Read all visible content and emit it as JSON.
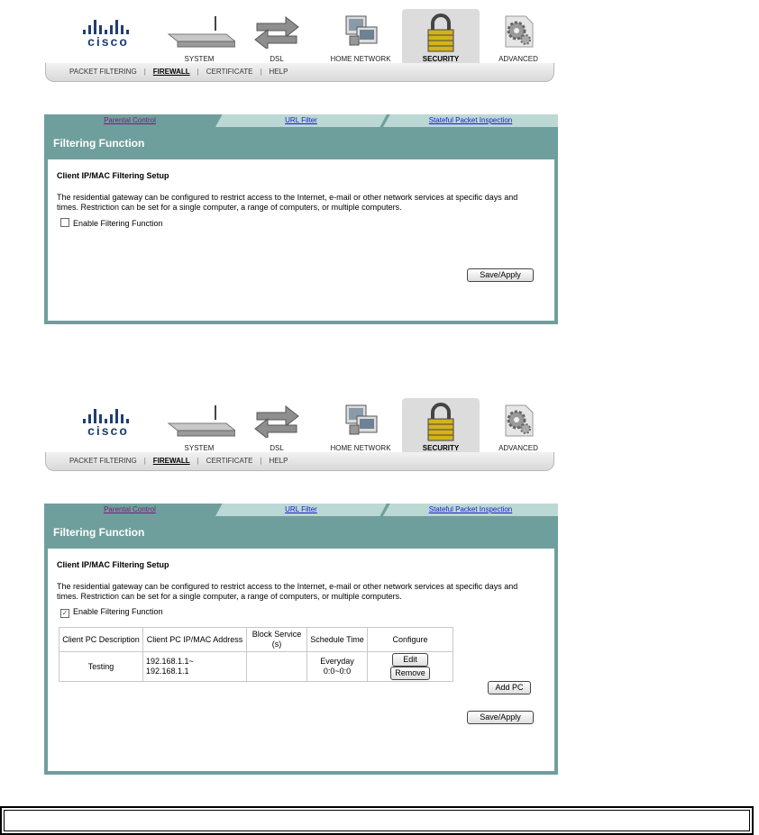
{
  "screens": [
    {
      "header": {
        "logo_text": "cisco",
        "nav": [
          {
            "label": "SYSTEM",
            "icon": "router-icon"
          },
          {
            "label": "DSL",
            "icon": "arrows-icon"
          },
          {
            "label": "HOME NETWORK",
            "icon": "computers-icon"
          },
          {
            "label": "SECURITY",
            "icon": "padlock-icon",
            "active": true
          },
          {
            "label": "ADVANCED",
            "icon": "gears-icon"
          }
        ],
        "subnav": [
          "PACKET FILTERING",
          "FIREWALL",
          "CERTIFICATE",
          "HELP"
        ],
        "subnav_current": "FIREWALL"
      },
      "tabs": [
        "Parental Control",
        "URL Filter",
        "Stateful Packet Inspection"
      ],
      "title": "Filtering Function",
      "subtitle": "Client IP/MAC Filtering Setup",
      "description": "The residential gateway can be configured to restrict access to the Internet, e-mail or other network services at specific days and times. Restriction can be set for a single computer, a range of computers, or multiple computers.",
      "checkbox_label": "Enable Filtering Function",
      "checkbox_checked": false,
      "save_label": "Save/Apply"
    },
    {
      "header": {
        "logo_text": "cisco",
        "nav": [
          {
            "label": "SYSTEM",
            "icon": "router-icon"
          },
          {
            "label": "DSL",
            "icon": "arrows-icon"
          },
          {
            "label": "HOME NETWORK",
            "icon": "computers-icon"
          },
          {
            "label": "SECURITY",
            "icon": "padlock-icon",
            "active": true
          },
          {
            "label": "ADVANCED",
            "icon": "gears-icon"
          }
        ],
        "subnav": [
          "PACKET FILTERING",
          "FIREWALL",
          "CERTIFICATE",
          "HELP"
        ],
        "subnav_current": "FIREWALL"
      },
      "tabs": [
        "Parental Control",
        "URL Filter",
        "Stateful Packet Inspection"
      ],
      "title": "Filtering Function",
      "subtitle": "Client IP/MAC Filtering Setup",
      "description": "The residential gateway can be configured to restrict access to the Internet, e-mail or other network services at specific days and times. Restriction can be set for a single computer, a range of computers, or multiple computers.",
      "checkbox_label": "Enable Filtering Function",
      "checkbox_checked": true,
      "checkbox_mark": "✓",
      "table": {
        "headers": [
          "Client PC Description",
          "Client PC IP/MAC Address",
          "Block Service (s)",
          "Schedule Time",
          "Configure"
        ],
        "rows": [
          {
            "description": "Testing",
            "address_line1": "192.168.1.1~",
            "address_line2": "192.168.1.1",
            "block_service": "",
            "schedule_line1": "Everyday",
            "schedule_line2": "0:0~0:0",
            "edit_label": "Edit",
            "remove_label": "Remove"
          }
        ]
      },
      "add_pc_label": "Add PC",
      "save_label": "Save/Apply"
    }
  ],
  "colors": {
    "panel_bg": "#6f9f9c",
    "tab_unselected": "#bcd8d5",
    "link": "#1a1ad6",
    "visited_link": "#7a1a7a"
  }
}
